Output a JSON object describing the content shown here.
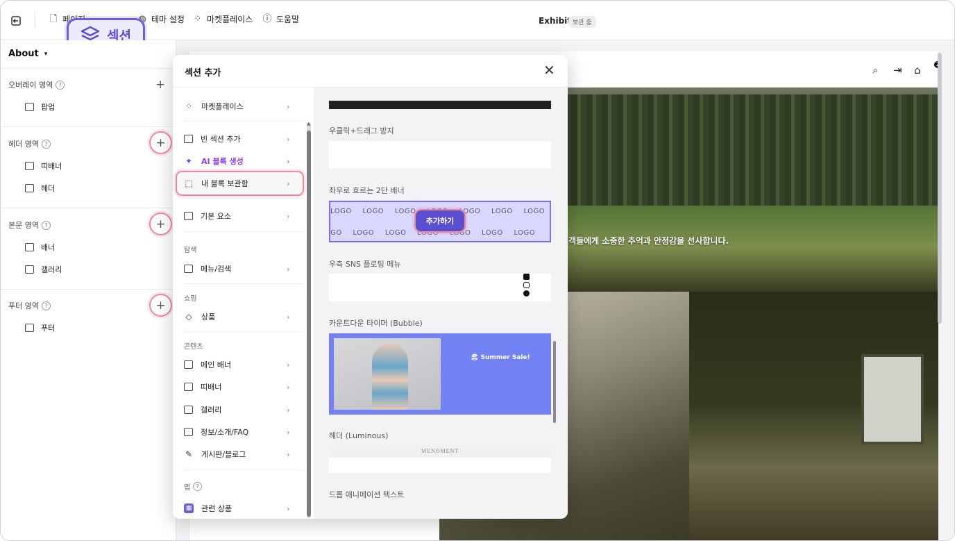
{
  "topbar": {
    "page_label": "페이지",
    "section_label": "섹션",
    "theme_label": "테마 설정",
    "market_label": "마켓플레이스",
    "help_label": "도움말",
    "site_title": "Exhibit",
    "draft_badge": "보관 중"
  },
  "left_panel": {
    "page_name": "About",
    "areas": [
      {
        "label": "오버레이 영역",
        "items": [
          "팝업"
        ]
      },
      {
        "label": "헤더 영역",
        "items": [
          "띠배너",
          "헤더"
        ]
      },
      {
        "label": "본문 영역",
        "items": [
          "배너",
          "갤러리"
        ]
      },
      {
        "label": "푸터 영역",
        "items": [
          "푸터"
        ]
      }
    ]
  },
  "modal": {
    "title": "섹션 추가",
    "categories": {
      "marketplace": "마켓플레이스",
      "empty_section": "빈 섹션 추가",
      "ai_block": "AI 블록 생성",
      "my_blocks": "내 블록 보관함",
      "basic": "기본 요소",
      "group_explore": "탐색",
      "menu_search": "메뉴/검색",
      "group_shopping": "쇼핑",
      "product": "상품",
      "group_content": "콘텐츠",
      "main_banner": "메인 배너",
      "strip_banner": "띠배너",
      "gallery": "갤러리",
      "info_faq": "정보/소개/FAQ",
      "board_blog": "게시판/블로그",
      "group_app": "앱",
      "related_products": "관련 상품"
    },
    "previews": {
      "right_click": "우클릭+드래그 방지",
      "two_row_banner": "좌우로 흐르는 2단 배너",
      "logo_text": "LOGO",
      "add_button": "추가하기",
      "sns_menu": "우측 SNS 플로팅 메뉴",
      "countdown": "카운트다운 타이머 (Bubble)",
      "summer_sale": "🏖 Summer Sale!",
      "luminous": "헤더 (Luminous)",
      "luminous_logo": "MENOMENT",
      "drop_text": "드롭 애니메이션 텍스트"
    }
  },
  "site": {
    "hero_text": "고객들에게 소중한 추억과 안정감을 선사합니다."
  },
  "colors": {
    "accent": "#5a4fd0",
    "highlight": "#e88a9a",
    "ai": "#8a3fd6"
  }
}
